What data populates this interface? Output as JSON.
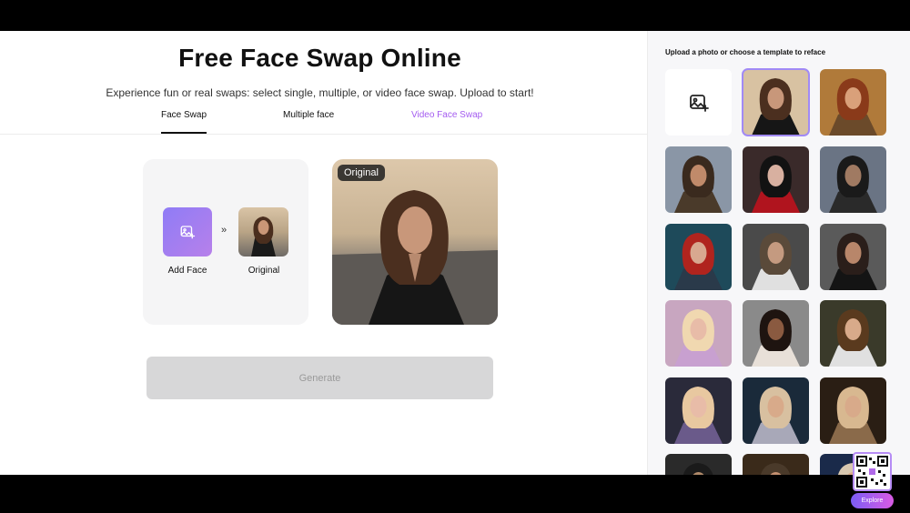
{
  "page": {
    "title": "Free Face Swap Online",
    "subtitle": "Experience fun or real swaps: select single, multiple, or video face swap. Upload to start!"
  },
  "tabs": [
    {
      "label": "Face Swap",
      "active": true
    },
    {
      "label": "Multiple face",
      "active": false
    },
    {
      "label": "Video Face Swap",
      "active": false,
      "color": "#a45cf0"
    }
  ],
  "swap_panel": {
    "add_face_label": "Add Face",
    "arrow": "»",
    "original_label": "Original"
  },
  "preview": {
    "badge": "Original"
  },
  "generate_label": "Generate",
  "sidebar": {
    "title": "Upload a photo or choose a template to reface",
    "templates": [
      {
        "kind": "upload",
        "icon": "add-image-icon"
      },
      {
        "kind": "photo",
        "selected": true
      },
      {
        "kind": "photo"
      },
      {
        "kind": "photo"
      },
      {
        "kind": "photo"
      },
      {
        "kind": "photo"
      },
      {
        "kind": "photo"
      },
      {
        "kind": "photo"
      },
      {
        "kind": "photo"
      },
      {
        "kind": "photo"
      },
      {
        "kind": "photo"
      },
      {
        "kind": "photo"
      },
      {
        "kind": "photo"
      },
      {
        "kind": "photo"
      },
      {
        "kind": "photo"
      },
      {
        "kind": "photo"
      },
      {
        "kind": "photo"
      },
      {
        "kind": "photo"
      }
    ]
  },
  "floating": {
    "explore_label": "Explore",
    "qr_icon": "qr-code-icon"
  },
  "colors": {
    "accent": "#a45cf0",
    "button_gradient_start": "#8f7cf6",
    "button_gradient_end": "#b780ea",
    "generate_disabled": "#d7d7d8"
  }
}
